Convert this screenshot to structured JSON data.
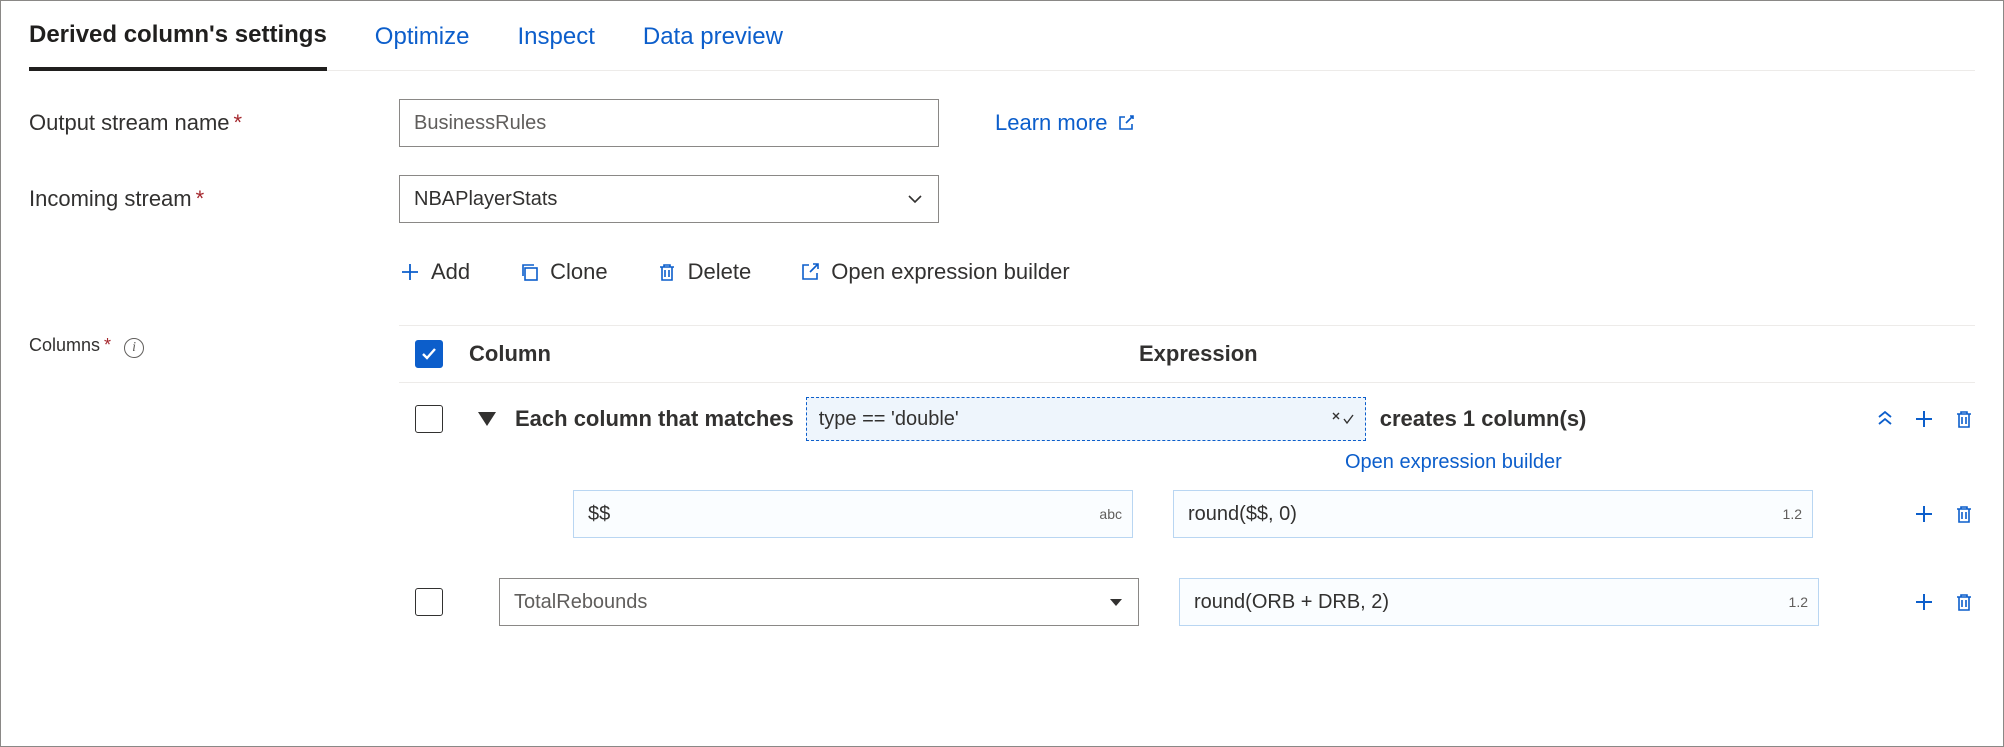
{
  "tabs": {
    "settings": "Derived column's settings",
    "optimize": "Optimize",
    "inspect": "Inspect",
    "preview": "Data preview"
  },
  "labels": {
    "output_stream": "Output stream name",
    "incoming_stream": "Incoming stream",
    "columns": "Columns",
    "learn_more": "Learn more"
  },
  "fields": {
    "output_stream_value": "BusinessRules",
    "incoming_stream_value": "NBAPlayerStats"
  },
  "toolbar": {
    "add": "Add",
    "clone": "Clone",
    "delete": "Delete",
    "open_builder": "Open expression builder"
  },
  "columns_header": {
    "column": "Column",
    "expression": "Expression"
  },
  "pattern_row": {
    "prefix": "Each column that matches",
    "condition": "type == 'double'",
    "suffix": "creates 1 column(s)",
    "sublink": "Open expression builder",
    "col_name": "$$",
    "col_tag": "abc",
    "expr": "round($$, 0)",
    "expr_tag": "1.2"
  },
  "row2": {
    "col_name": "TotalRebounds",
    "expr": "round(ORB + DRB, 2)",
    "expr_tag": "1.2"
  }
}
